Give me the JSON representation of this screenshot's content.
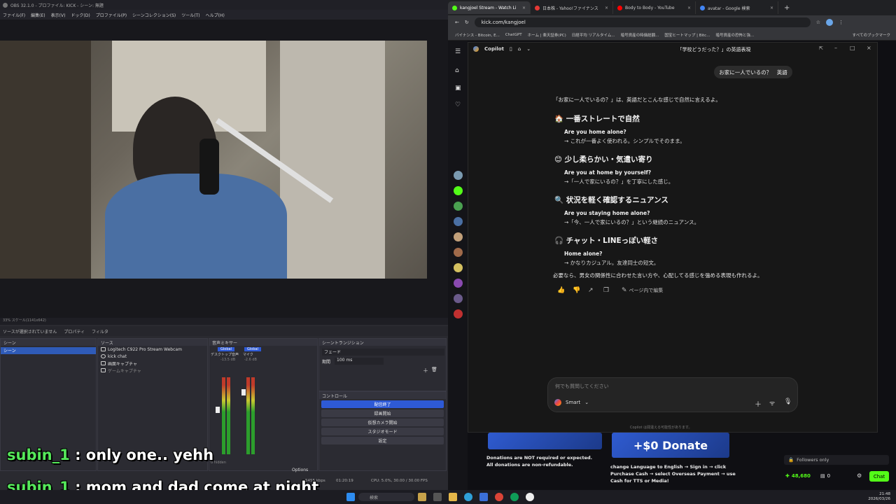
{
  "obs": {
    "title": "OBS 32.1.0 - プロファイル: KICK - シーン: 無題",
    "menu": [
      "ファイル(F)",
      "編集(E)",
      "表示(V)",
      "ドック(D)",
      "プロファイル(P)",
      "シーンコレクション(S)",
      "ツール(T)",
      "ヘルプ(H)"
    ],
    "preview_info": "33% スケール(1141x642)",
    "status_bar": {
      "no_source": "ソースが選択されていません",
      "properties": "プロパティ",
      "filters": "フィルタ"
    },
    "scenes": {
      "title": "シーン",
      "items": [
        "シーン"
      ]
    },
    "sources": {
      "title": "ソース",
      "items": [
        "Logitech C922 Pro Stream Webcam",
        "kick chat",
        "画面キャプチャ",
        "ゲームキャプチャ"
      ]
    },
    "mixer": {
      "title": "音声ミキサー",
      "channels": [
        {
          "name": "デスクトップ音声",
          "label": "Global",
          "db": "-13.5 dB",
          "level": 0.62
        },
        {
          "name": "マイク",
          "label": "Global",
          "db": "-2.6 dB",
          "level": 0.85
        }
      ],
      "hidden": "0 hidden"
    },
    "transitions": {
      "title": "シーントランジション",
      "type": "フェード",
      "duration_label": "期間",
      "duration": "100 ms"
    },
    "controls": {
      "title": "コントロール",
      "buttons": [
        "配信終了",
        "録画開始",
        "仮想カメラ開始",
        "スタジオモード",
        "設定"
      ]
    },
    "options": "Options",
    "stats": {
      "live": "01:20:19",
      "cpu": "CPU: 5.0%, 30.00 / 30.00 FPS",
      "kbps": "5455 kbps"
    }
  },
  "chat_overlay": [
    {
      "name": "subin_1",
      "message": ": only one.. yehh"
    },
    {
      "name": "subin_1",
      "message": ": mom and dad come at night"
    }
  ],
  "browser": {
    "tabs": [
      {
        "label": "kangjoel Stream - Watch Li",
        "active": true,
        "color": "#53fc18"
      },
      {
        "label": "日本株 - Yahoo!ファイナンス",
        "active": false,
        "color": "#e53935"
      },
      {
        "label": "Body to Body - YouTube",
        "active": false,
        "color": "#ff0000"
      },
      {
        "label": "avatar - Google 検索",
        "active": false,
        "color": "#4285f4"
      }
    ],
    "url": "kick.com/kangjoel",
    "bookmarks": [
      "バイナンス - Bitcoin, E...",
      "ChatGPT",
      "ホーム | 楽天証券(PC)",
      "日経平均 リアルタイム...",
      "暗号資産の時価総額...",
      "国宝ヒートマップ | Bitc...",
      "暗号資産の恐怖と強...",
      "すべてのブックマーク"
    ]
  },
  "copilot": {
    "app_name": "Copilot",
    "conversation_title": "「学校どうだった？」の英語表現",
    "user_message": "お家に一人でいるの？　英語",
    "intro": "「お家に一人でいるの？」は、英語だとこんな感じで自然に言えるよ。",
    "sections": [
      {
        "icon": "🏠",
        "heading": "一番ストレートで自然",
        "phrase": "Are you home alone?",
        "note": "→ これが一番よく使われる。シンプルでそのまま。"
      },
      {
        "icon": "😊",
        "heading": "少し柔らかい・気遣い寄り",
        "phrase": "Are you at home by yourself?",
        "note": "→「一人で家にいるの？」を丁寧にした感じ。"
      },
      {
        "icon": "🔍",
        "heading": "状況を軽く確認するニュアンス",
        "phrase": "Are you staying home alone?",
        "note": "→「今、一人で家にいるの？」という継続のニュアンス。"
      },
      {
        "icon": "🎧",
        "heading": "チャット・LINEっぽい軽さ",
        "phrase": "Home alone?",
        "note": "→ かなりカジュアル。友達同士の短文。"
      }
    ],
    "outro": "必要なら、男女の関係性に合わせた言い方や、心配してる感じを強める表現も作れるよ。",
    "edit_label": "ページ内で編集",
    "input_placeholder": "何でも質問してください",
    "mode": "Smart",
    "disclaimer": "Copilot は間違える可能性があります。"
  },
  "kick": {
    "donation_banner": "+$0 Donate",
    "donation_note_1": "Donations are NOT required or expected.",
    "donation_note_2": "All donations are non-refundable.",
    "donate_instructions": "change Language to English → Sign in → click Purchase Cash → select Overseas Payment → use Cash for TTS or Media!",
    "followers_only": "Followers only",
    "points": "48,680",
    "zero": "0",
    "chat_button": "Chat",
    "accent": "#53fc18"
  },
  "taskbar": {
    "search": "検索",
    "time": "21:48",
    "date": "2026/03/26"
  }
}
